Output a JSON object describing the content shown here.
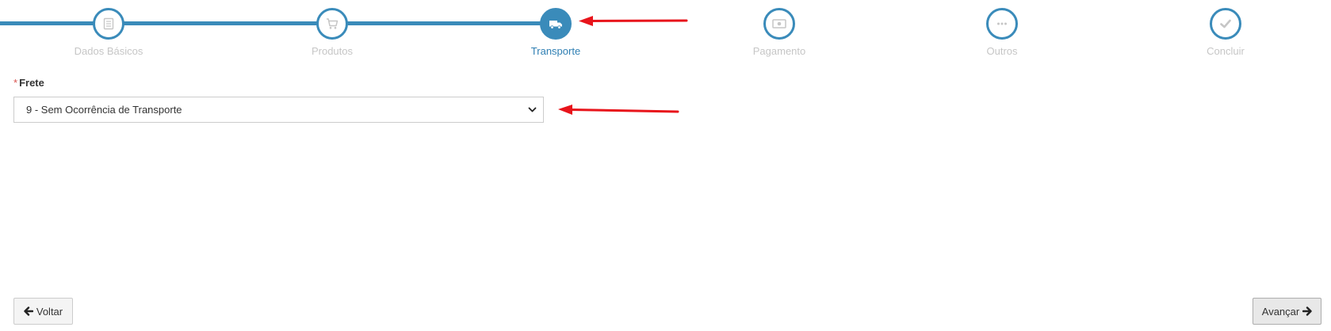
{
  "stepper": {
    "steps": [
      {
        "label": "Dados Básicos",
        "icon": "document-icon",
        "active": false
      },
      {
        "label": "Produtos",
        "icon": "cart-icon",
        "active": false
      },
      {
        "label": "Transporte",
        "icon": "truck-icon",
        "active": true
      },
      {
        "label": "Pagamento",
        "icon": "money-icon",
        "active": false
      },
      {
        "label": "Outros",
        "icon": "ellipsis-icon",
        "active": false
      },
      {
        "label": "Concluir",
        "icon": "check-icon",
        "active": false
      }
    ]
  },
  "form": {
    "required_mark": "*",
    "frete_label": "Frete",
    "frete_value": "9 - Sem Ocorrência de Transporte"
  },
  "buttons": {
    "back_label": "Voltar",
    "next_label": "Avançar"
  },
  "colors": {
    "accent": "#3a8bba",
    "inactive_label": "#c6c6c6",
    "annotation": "#e8141b"
  }
}
